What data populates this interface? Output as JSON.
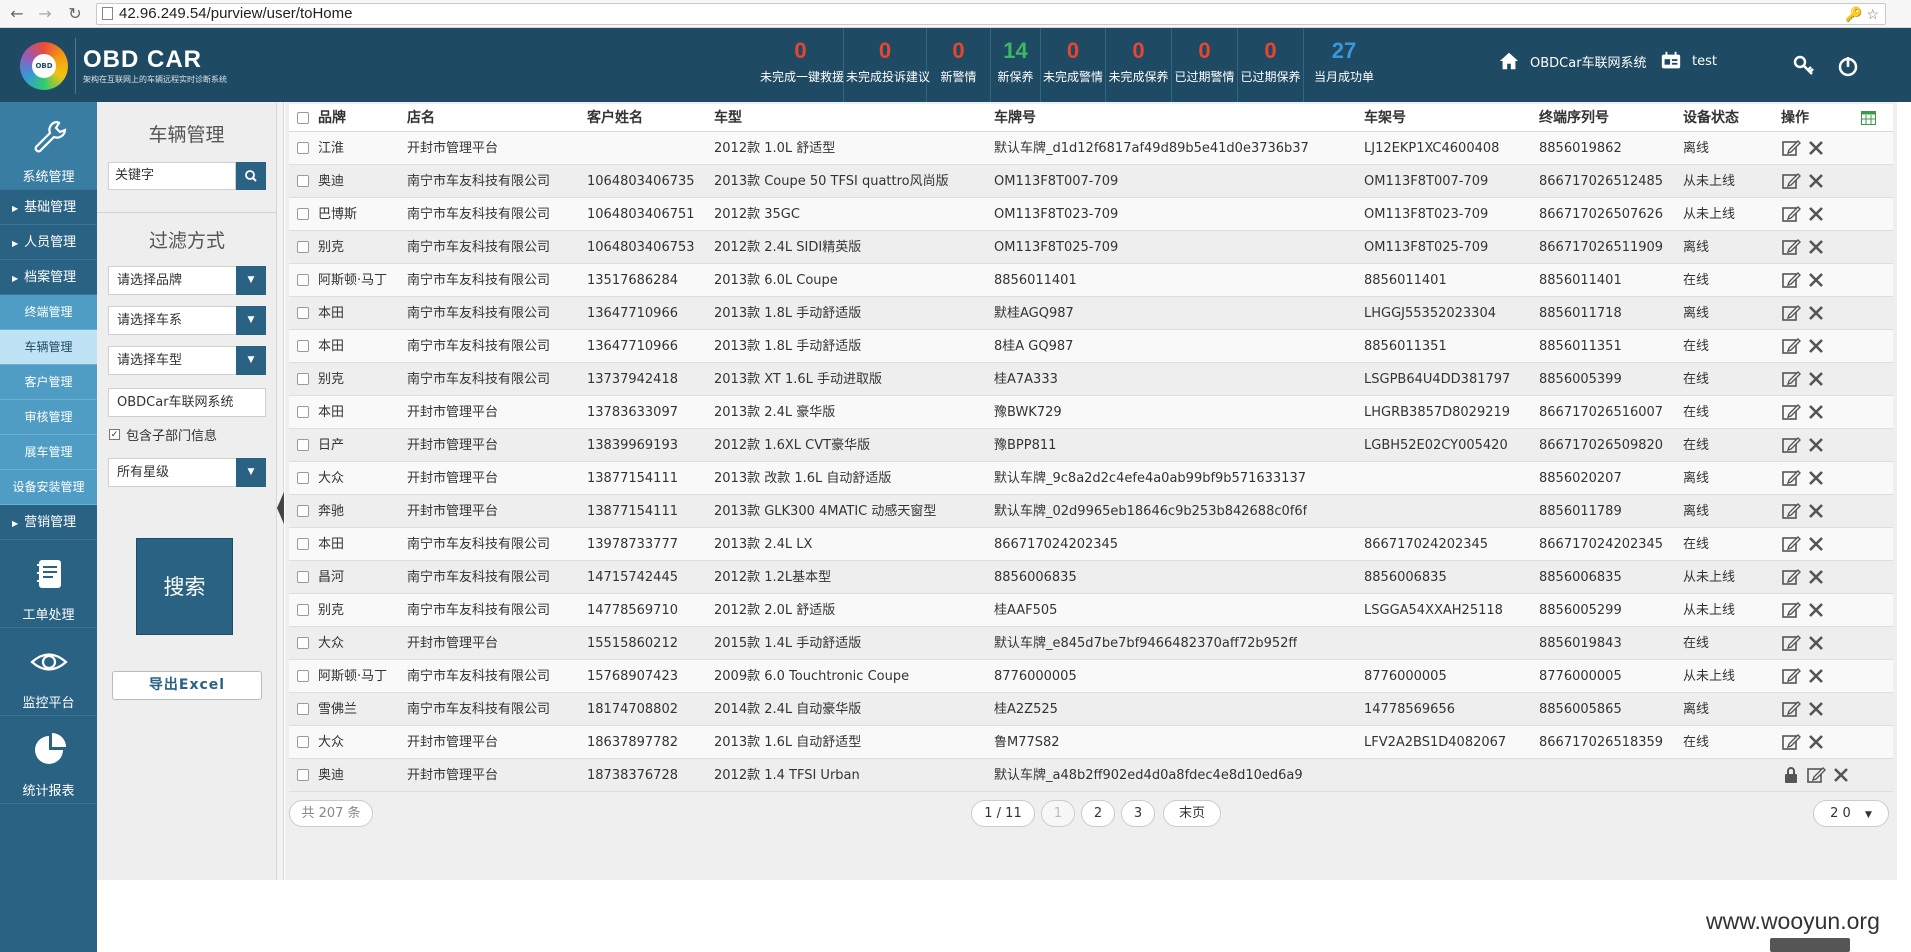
{
  "browser": {
    "back": "←",
    "forward": "→",
    "reload": "↻",
    "url": "42.96.249.54/purview/user/toHome",
    "url_right": "🔑 ☆"
  },
  "header": {
    "logo_title": "OBD CAR",
    "logo_sub": "架构在互联网上的车辆远程实时诊断系统",
    "logo_mark": "OBD",
    "stats": [
      {
        "num": "0",
        "label": "未完成一键救援",
        "color": "red"
      },
      {
        "num": "0",
        "label": "未完成投诉建议",
        "color": "red"
      },
      {
        "num": "0",
        "label": "新警情",
        "color": "red"
      },
      {
        "num": "14",
        "label": "新保养",
        "color": "green"
      },
      {
        "num": "0",
        "label": "未完成警情",
        "color": "red"
      },
      {
        "num": "0",
        "label": "未完成保养",
        "color": "red"
      },
      {
        "num": "0",
        "label": "已过期警情",
        "color": "red"
      },
      {
        "num": "0",
        "label": "已过期保养",
        "color": "red"
      },
      {
        "num": "27",
        "label": "当月成功单",
        "color": "blue"
      }
    ],
    "system_label": "OBDCar车联网系统",
    "user_label": "test"
  },
  "left_nav": {
    "top_block": "系统管理",
    "items": [
      {
        "label": "基础管理",
        "type": "item"
      },
      {
        "label": "人员管理",
        "type": "item"
      },
      {
        "label": "档案管理",
        "type": "item"
      },
      {
        "label": "终端管理",
        "type": "sub"
      },
      {
        "label": "车辆管理",
        "type": "sub-active"
      },
      {
        "label": "客户管理",
        "type": "sub"
      },
      {
        "label": "审核管理",
        "type": "sub"
      },
      {
        "label": "展车管理",
        "type": "sub"
      },
      {
        "label": "设备安装管理",
        "type": "sub"
      },
      {
        "label": "营销管理",
        "type": "item"
      }
    ],
    "blocks": [
      "工单处理",
      "监控平台",
      "统计报表"
    ]
  },
  "filter": {
    "title": "车辆管理",
    "keyword_value": "关键字",
    "filter_title": "过滤方式",
    "brand_select": "请选择品牌",
    "series_select": "请选择车系",
    "model_select": "请选择车型",
    "org_value": "OBDCar车联网系统",
    "include_sub": "包含子部门信息",
    "star_select": "所有星级",
    "search_btn": "搜索",
    "excel_btn": "导出Excel"
  },
  "table": {
    "headers": [
      "品牌",
      "店名",
      "客户姓名",
      "车型",
      "车牌号",
      "车架号",
      "终端序列号",
      "设备状态",
      "操作"
    ],
    "rows": [
      [
        "江淮",
        "开封市管理平台",
        "",
        "2012款 1.0L 舒适型",
        "默认车牌_d1d12f6817af49d89b5e41d0e3736b37",
        "LJ12EKP1XC4600408",
        "8856019862",
        "离线"
      ],
      [
        "奥迪",
        "南宁市车友科技有限公司",
        "1064803406735",
        "2013款 Coupe 50 TFSI quattro风尚版",
        "OM113F8T007-709",
        "OM113F8T007-709",
        "866717026512485",
        "从未上线"
      ],
      [
        "巴博斯",
        "南宁市车友科技有限公司",
        "1064803406751",
        "2012款 35GC",
        "OM113F8T023-709",
        "OM113F8T023-709",
        "866717026507626",
        "从未上线"
      ],
      [
        "别克",
        "南宁市车友科技有限公司",
        "1064803406753",
        "2012款 2.4L SIDI精英版",
        "OM113F8T025-709",
        "OM113F8T025-709",
        "866717026511909",
        "离线"
      ],
      [
        "阿斯顿·马丁",
        "南宁市车友科技有限公司",
        "13517686284",
        "2013款 6.0L Coupe",
        "8856011401",
        "8856011401",
        "8856011401",
        "在线"
      ],
      [
        "本田",
        "南宁市车友科技有限公司",
        "13647710966",
        "2013款 1.8L 手动舒适版",
        "默桂AGQ987",
        "LHGGJ55352023304",
        "8856011718",
        "离线"
      ],
      [
        "本田",
        "南宁市车友科技有限公司",
        "13647710966",
        "2013款 1.8L 手动舒适版",
        "8桂A GQ987",
        "8856011351",
        "8856011351",
        "在线"
      ],
      [
        "别克",
        "南宁市车友科技有限公司",
        "13737942418",
        "2013款 XT 1.6L 手动进取版",
        "桂A7A333",
        "LSGPB64U4DD381797",
        "8856005399",
        "在线"
      ],
      [
        "本田",
        "开封市管理平台",
        "13783633097",
        "2013款 2.4L 豪华版",
        "豫BWK729",
        "LHGRB3857D8029219",
        "866717026516007",
        "在线"
      ],
      [
        "日产",
        "开封市管理平台",
        "13839969193",
        "2012款 1.6XL CVT豪华版",
        "豫BPP811",
        "LGBH52E02CY005420",
        "866717026509820",
        "在线"
      ],
      [
        "大众",
        "开封市管理平台",
        "13877154111",
        "2013款 改款 1.6L 自动舒适版",
        "默认车牌_9c8a2d2c4efe4a0ab99bf9b571633137",
        "",
        "8856020207",
        "离线"
      ],
      [
        "奔驰",
        "开封市管理平台",
        "13877154111",
        "2013款 GLK300 4MATIC 动感天窗型",
        "默认车牌_02d9965eb18646c9b253b842688c0f6f",
        "",
        "8856011789",
        "离线"
      ],
      [
        "本田",
        "南宁市车友科技有限公司",
        "13978733777",
        "2013款 2.4L LX",
        "866717024202345",
        "866717024202345",
        "866717024202345",
        "在线"
      ],
      [
        "昌河",
        "南宁市车友科技有限公司",
        "14715742445",
        "2012款 1.2L基本型",
        "8856006835",
        "8856006835",
        "8856006835",
        "从未上线"
      ],
      [
        "别克",
        "南宁市车友科技有限公司",
        "14778569710",
        "2012款 2.0L 舒适版",
        "桂AAF505",
        "LSGGA54XXAH25118",
        "8856005299",
        "从未上线"
      ],
      [
        "大众",
        "开封市管理平台",
        "15515860212",
        "2015款 1.4L 手动舒适版",
        "默认车牌_e845d7be7bf9466482370aff72b952ff",
        "",
        "8856019843",
        "在线"
      ],
      [
        "阿斯顿·马丁",
        "南宁市车友科技有限公司",
        "15768907423",
        "2009款 6.0 Touchtronic Coupe",
        "8776000005",
        "8776000005",
        "8776000005",
        "从未上线"
      ],
      [
        "雪佛兰",
        "南宁市车友科技有限公司",
        "18174708802",
        "2014款 2.4L 自动豪华版",
        "桂A2Z525",
        "14778569656",
        "8856005865",
        "离线"
      ],
      [
        "大众",
        "开封市管理平台",
        "18637897782",
        "2013款 1.6L 自动舒适型",
        "鲁M77S82",
        "LFV2A2BS1D4082067",
        "866717026518359",
        "在线"
      ],
      [
        "奥迪",
        "开封市管理平台",
        "18738376728",
        "2012款 1.4 TFSI Urban",
        "默认车牌_a48b2ff902ed4d0a8fdec4e8d10ed6a9",
        "",
        "",
        ""
      ]
    ]
  },
  "pager": {
    "total": "共 207 条",
    "page_info": "1 / 11",
    "pages": [
      "1",
      "2",
      "3"
    ],
    "last": "末页",
    "per_page": "2 0"
  },
  "watermark": "www.wooyun.org"
}
